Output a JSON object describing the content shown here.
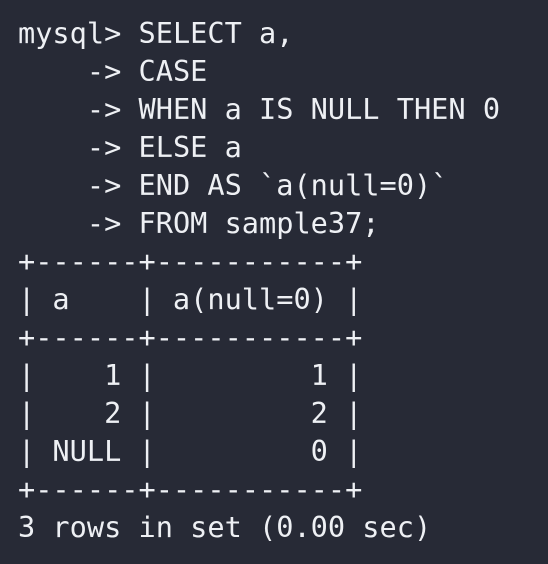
{
  "terminal": {
    "query_lines": [
      {
        "prefix": "mysql> ",
        "text": "SELECT a,"
      },
      {
        "prefix": "    -> ",
        "text": "CASE"
      },
      {
        "prefix": "    -> ",
        "text": "WHEN a IS NULL THEN 0"
      },
      {
        "prefix": "    -> ",
        "text": "ELSE a"
      },
      {
        "prefix": "    -> ",
        "text": "END AS `a(null=0)`"
      },
      {
        "prefix": "    -> ",
        "text": "FROM sample37;"
      }
    ],
    "table": {
      "border_top": "+------+-----------+",
      "header": "| a    | a(null=0) |",
      "border_mid": "+------+-----------+",
      "rows": [
        "|    1 |         1 |",
        "|    2 |         2 |",
        "| NULL |         0 |"
      ],
      "border_bottom": "+------+-----------+"
    },
    "result_summary": "3 rows in set (0.00 sec)"
  }
}
